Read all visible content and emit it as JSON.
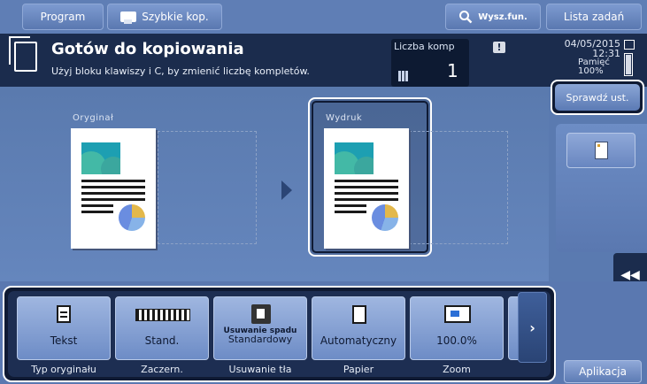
{
  "topbar": {
    "program_label": "Program",
    "quick_label": "Szybkie kop.",
    "search_label": "Wysz.fun.",
    "jobs_label": "Lista zadań"
  },
  "status": {
    "title": "Gotów do kopiowania",
    "subtitle": "Użyj bloku klawiszy i C, by zmienić liczbę kompletów.",
    "count_label": "Liczba komp",
    "count_value": "1",
    "date": "04/05/2015",
    "time": "12:31",
    "memory_label": "Pamięć",
    "memory_value": "100%"
  },
  "main": {
    "original_label": "Oryginał",
    "output_label": "Wydruk",
    "check_label": "Sprawdź ust."
  },
  "functions": [
    {
      "value": "Tekst",
      "caption": "Typ oryginału",
      "icon": "document-icon"
    },
    {
      "value": "Stand.",
      "caption": "Zaczern.",
      "icon": "density-icon"
    },
    {
      "value": "Standardowy",
      "value_top": "Usuwanie spadu",
      "caption": "Usuwanie tła",
      "icon": "background-removal-icon"
    },
    {
      "value": "Automatyczny",
      "caption": "Papier",
      "icon": "paper-icon"
    },
    {
      "value": "100.0%",
      "caption": "Zoom",
      "icon": "zoom-icon"
    }
  ],
  "app_label": "Aplikacja",
  "colors": {
    "background": "#5a7ab0",
    "status_bar": "#1b2c4d",
    "accent": "#8ba6d6"
  }
}
